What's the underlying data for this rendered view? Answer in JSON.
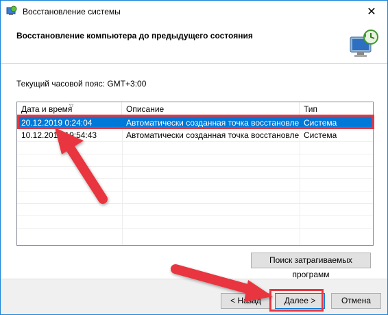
{
  "window": {
    "title": "Восстановление системы",
    "close_glyph": "✕"
  },
  "header": {
    "title": "Восстановление компьютера до предыдущего состояния",
    "icon": "system-restore-monitor-icon"
  },
  "timezone_label": "Текущий часовой пояс: GMT+3:00",
  "list": {
    "columns": [
      "Дата и время",
      "Описание",
      "Тип"
    ],
    "sort_indicator": "▽",
    "rows": [
      {
        "date": "20.12.2019 0:24:04",
        "description": "Автоматически созданная точка восстановле...",
        "type": "Система",
        "selected": true
      },
      {
        "date": "10.12.2019 19:54:43",
        "description": "Автоматически созданная точка восстановле...",
        "type": "Система",
        "selected": false
      }
    ]
  },
  "buttons": {
    "affected": "Поиск затрагиваемых программ",
    "back": "< Назад",
    "next": "Далее >",
    "cancel": "Отмена"
  },
  "colors": {
    "accent": "#0078d7",
    "highlight": "#e8353f"
  }
}
